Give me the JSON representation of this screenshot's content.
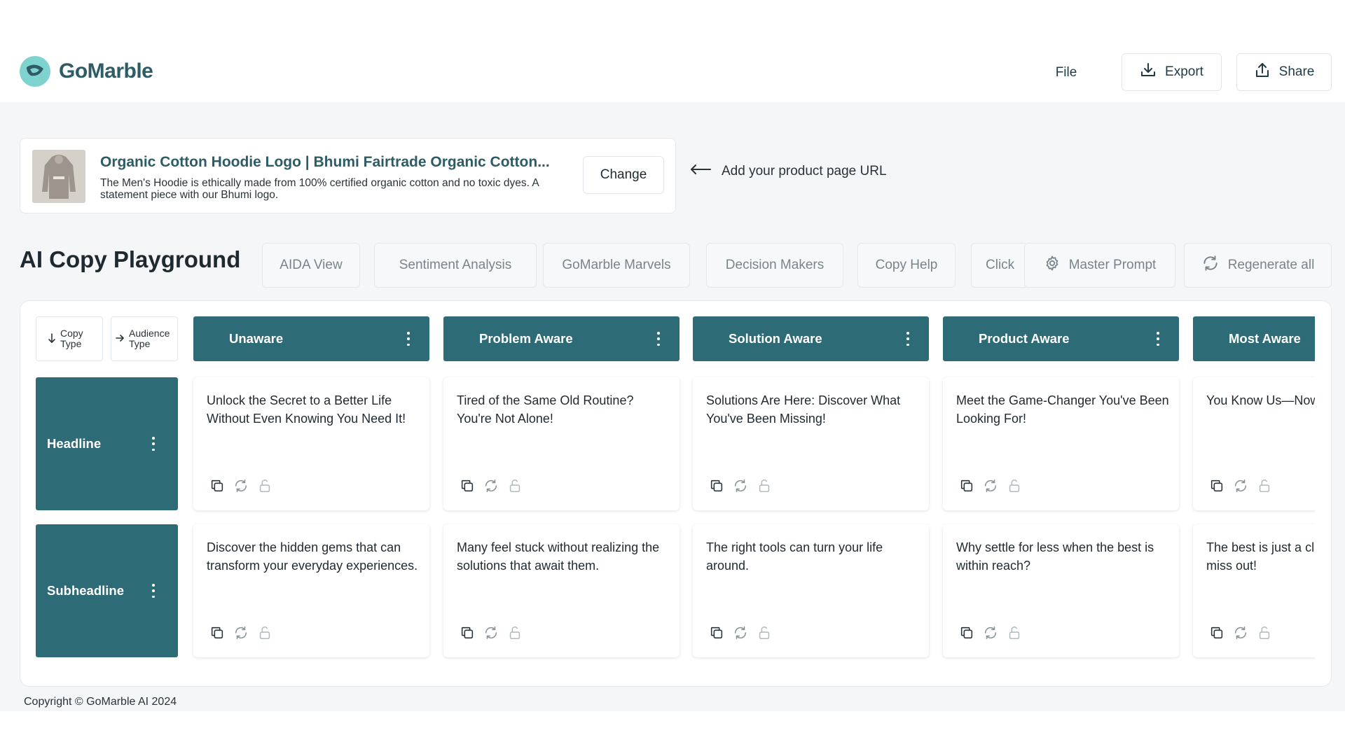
{
  "header": {
    "logo_text": "GoMarble",
    "file_label": "File",
    "export_label": "Export",
    "share_label": "Share"
  },
  "product": {
    "title": "Organic Cotton Hoodie Logo | Bhumi Fairtrade Organic Cotton...",
    "description": "The Men's Hoodie is ethically made from 100% certified organic cotton and no toxic dyes. A statement piece with our Bhumi logo.",
    "change_label": "Change",
    "url_hint": "Add your product page URL"
  },
  "playground": {
    "title": "AI Copy Playground",
    "tabs": [
      "AIDA View",
      "Sentiment Analysis",
      "GoMarble Marvels",
      "Decision Makers",
      "Copy Help",
      "Click"
    ],
    "master_prompt_label": "Master Prompt",
    "regenerate_label": "Regenerate all"
  },
  "grid": {
    "copy_type_label": "Copy Type",
    "audience_type_label": "Audience Type",
    "columns": [
      "Unaware",
      "Problem Aware",
      "Solution Aware",
      "Product Aware",
      "Most Aware"
    ],
    "rows": [
      {
        "label": "Headline",
        "cells": [
          "Unlock the Secret to a Better Life Without Even Knowing You Need It!",
          "Tired of the Same Old Routine? You're Not Alone!",
          "Solutions Are Here: Discover What You've Been Missing!",
          "Meet the Game-Changer You've Been Looking For!",
          "You Know Us—Now Make It Yours!"
        ]
      },
      {
        "label": "Subheadline",
        "cells": [
          "Discover the hidden gems that can transform your everyday experiences.",
          "Many feel stuck without realizing the solutions that await them.",
          "The right tools can turn your life around.",
          "Why settle for less when the best is within reach?",
          "The best is just a click away—don't miss out!"
        ]
      }
    ]
  },
  "footer": {
    "copyright": "Copyright © GoMarble AI 2024"
  },
  "colors": {
    "accent": "#2d6b77",
    "brand_text": "#2d5b66",
    "logo_mark": "#7fd3cf"
  }
}
